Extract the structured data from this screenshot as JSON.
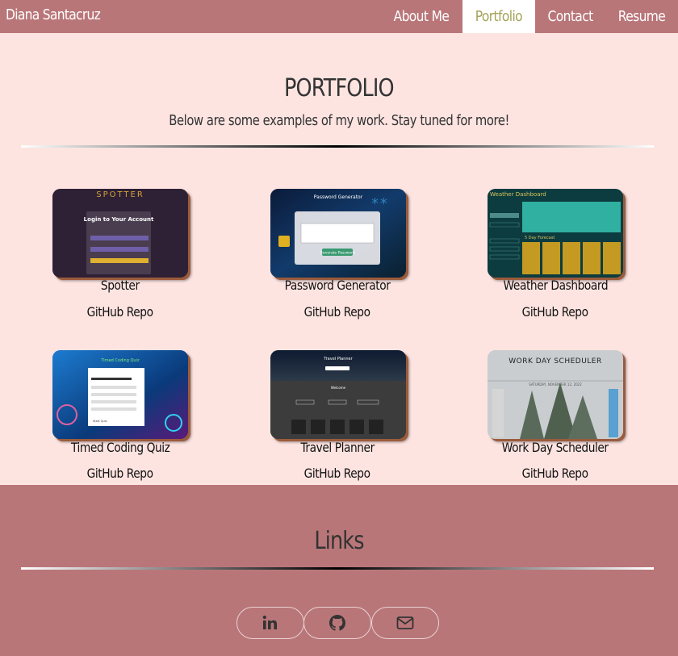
{
  "nav": {
    "brand": "Diana Santacruz",
    "links": [
      {
        "label": "About Me",
        "active": false
      },
      {
        "label": "Portfolio",
        "active": true
      },
      {
        "label": "Contact",
        "active": false
      },
      {
        "label": "Resume",
        "active": false
      }
    ]
  },
  "portfolio": {
    "title": "PORTFOLIO",
    "subtitle": "Below are some examples of my work. Stay tuned for more!",
    "projects": [
      {
        "name": "Spotter",
        "repo_label": "GitHub Repo",
        "thumb_heading": "SPOTTER",
        "thumb_text": "Login to Your Account"
      },
      {
        "name": "Password Generator",
        "repo_label": "GitHub Repo",
        "thumb_heading": "Password Generator",
        "thumb_text": "Generate Password"
      },
      {
        "name": "Weather Dashboard",
        "repo_label": "GitHub Repo",
        "thumb_heading": "Weather Dashboard",
        "thumb_text": "5 Day Forecast"
      },
      {
        "name": "Timed Coding Quiz",
        "repo_label": "GitHub Repo",
        "thumb_heading": "Timed Coding Quiz",
        "thumb_text": "Start Quiz"
      },
      {
        "name": "Travel Planner",
        "repo_label": "GitHub Repo",
        "thumb_heading": "Travel Planner",
        "thumb_text": "Welcome"
      },
      {
        "name": "Work Day Scheduler",
        "repo_label": "GitHub Repo",
        "thumb_heading": "WORK DAY SCHEDULER",
        "thumb_text": "SATURDAY, NOVEMBER 12, 2022"
      }
    ]
  },
  "footer": {
    "title": "Links",
    "social": [
      {
        "icon": "linkedin-icon",
        "label": "in"
      },
      {
        "icon": "github-icon"
      },
      {
        "icon": "mail-icon"
      }
    ]
  },
  "colors": {
    "nav_bg": "#b97679",
    "page_bg": "#fde4e1",
    "active_link": "#a4a259",
    "footer_bg": "#b97679"
  }
}
